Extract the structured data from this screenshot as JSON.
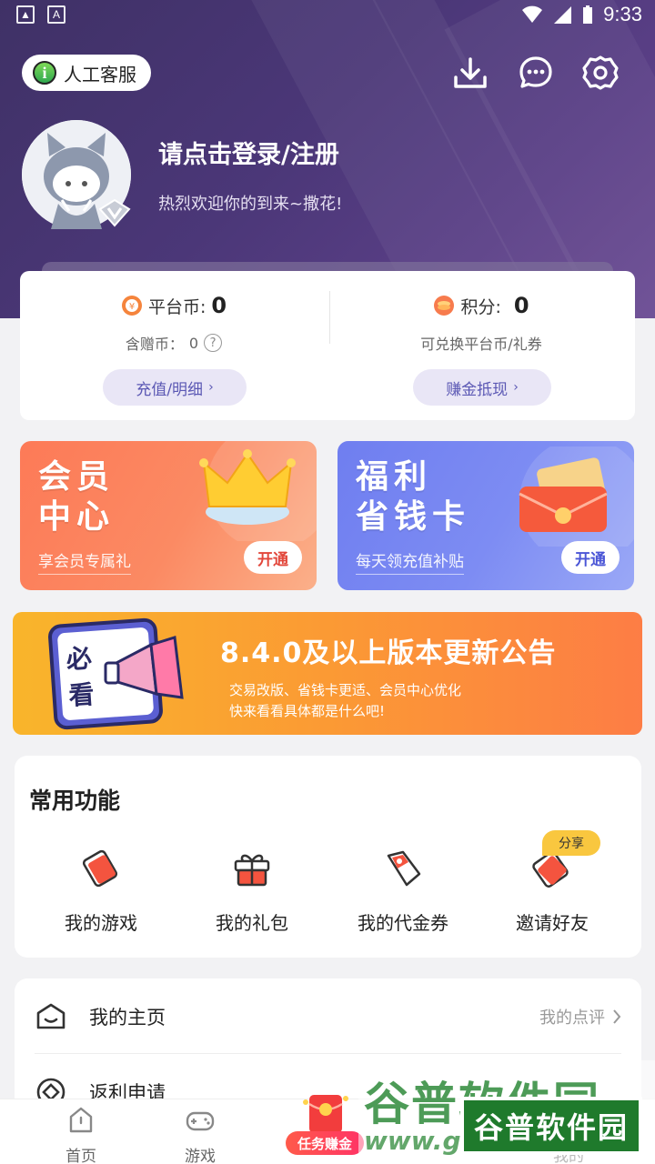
{
  "status_bar": {
    "time": "9:33",
    "left_icons": [
      "image-icon",
      "a-icon"
    ]
  },
  "header": {
    "customer_service": "人工客服",
    "icons": [
      "download-icon",
      "message-icon",
      "settings-icon"
    ],
    "login_title": "请点击登录/注册",
    "welcome": "热烈欢迎你的到来~撒花!"
  },
  "wallet": {
    "platform_coin_label": "平台币:",
    "platform_coin_value": "0",
    "gift_coin_label": "含赠币：",
    "gift_coin_value": "0",
    "recharge_button": "充值/明细",
    "points_label": "积分:",
    "points_value": "0",
    "points_desc": "可兑换平台币/礼券",
    "withdraw_button": "赚金抵现"
  },
  "promos": {
    "vip": {
      "title_line1": "会员",
      "title_line2": "中心",
      "subtitle": "享会员专属礼",
      "button": "开通"
    },
    "card": {
      "title_line1": "福利",
      "title_line2": "省钱卡",
      "subtitle": "每天领充值补贴",
      "button": "开通"
    }
  },
  "notice": {
    "badge_line1": "必",
    "badge_line2": "看",
    "title": "8.4.0及以上版本更新公告",
    "line1": "交易改版、省钱卡更适、会员中心优化",
    "line2": "快来看看具体都是什么吧!"
  },
  "common_functions": {
    "heading": "常用功能",
    "items": [
      {
        "label": "我的游戏",
        "icon": "game-card-icon"
      },
      {
        "label": "我的礼包",
        "icon": "gift-box-icon"
      },
      {
        "label": "我的代金券",
        "icon": "coupon-tag-icon"
      },
      {
        "label": "邀请好友",
        "icon": "invite-card-icon"
      }
    ],
    "share_tag": "分享"
  },
  "menu": {
    "items": [
      {
        "label": "我的主页",
        "right": "我的点评",
        "icon": "home-face-icon"
      },
      {
        "label": "返利申请",
        "right": "",
        "icon": "rebate-icon"
      }
    ]
  },
  "tabbar": {
    "tabs": [
      "首页",
      "游戏",
      "我的"
    ],
    "task_label": "任务赚金"
  },
  "watermark": {
    "text": "谷普软件园",
    "url": "www.gu",
    "boxed": "谷普软件园"
  },
  "colors": {
    "hero": "#4b3778",
    "accent": "#5b58b4",
    "vip_button_text": "#e2463a",
    "card_button_text": "#4a55d6"
  }
}
